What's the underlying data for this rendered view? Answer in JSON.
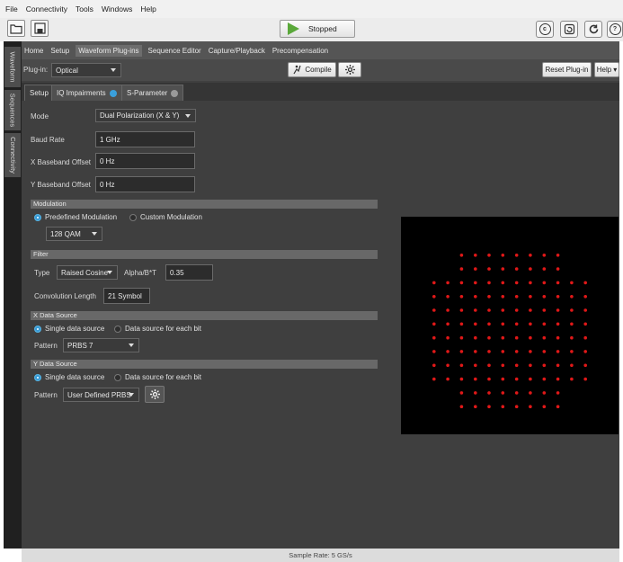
{
  "menu": [
    "File",
    "Connectivity",
    "Tools",
    "Windows",
    "Help"
  ],
  "toolbar": {
    "run_status": "Stopped"
  },
  "sidebar_tabs": [
    "Waveform",
    "Sequences",
    "Connectivity"
  ],
  "nav_tabs": [
    "Home",
    "Setup",
    "Waveform Plug-ins",
    "Sequence Editor",
    "Capture/Playback",
    "Precompensation"
  ],
  "nav_active": "Waveform Plug-ins",
  "plugin": {
    "label": "Plug-in:",
    "value": "Optical",
    "compile_label": "Compile",
    "reset_label": "Reset Plug-in",
    "help_label": "Help"
  },
  "subtabs": {
    "setup": "Setup",
    "iq": "IQ Impairments",
    "sparam": "S-Parameter",
    "iq_dot_color": "#3aa0dc",
    "sparam_dot_color": "#9a9a9a"
  },
  "form": {
    "mode_label": "Mode",
    "mode_value": "Dual Polarization (X & Y)",
    "baud_label": "Baud Rate",
    "baud_value": "1 GHz",
    "xoff_label": "X Baseband Offset",
    "xoff_value": "0 Hz",
    "yoff_label": "Y Baseband Offset",
    "yoff_value": "0 Hz"
  },
  "modulation": {
    "header": "Modulation",
    "predefined": "Predefined Modulation",
    "custom": "Custom Modulation",
    "value": "128 QAM"
  },
  "filter": {
    "header": "Filter",
    "type_label": "Type",
    "type_value": "Raised Cosine",
    "alpha_label": "Alpha/B*T",
    "alpha_value": "0.35",
    "conv_label": "Convolution Length",
    "conv_value": "21 Symbol"
  },
  "xsource": {
    "header": "X Data Source",
    "single": "Single data source",
    "each": "Data source for each bit",
    "pattern_label": "Pattern",
    "pattern_value": "PRBS 7"
  },
  "ysource": {
    "header": "Y Data Source",
    "single": "Single data source",
    "each": "Data source for each bit",
    "pattern_label": "Pattern",
    "pattern_value": "User Defined PRBS"
  },
  "constellation": {
    "modulation": "128 QAM",
    "point_color": "#e01818",
    "background": "#000000",
    "grid_size": 12
  },
  "status": {
    "sample_rate": "Sample Rate: 5 GS/s"
  }
}
